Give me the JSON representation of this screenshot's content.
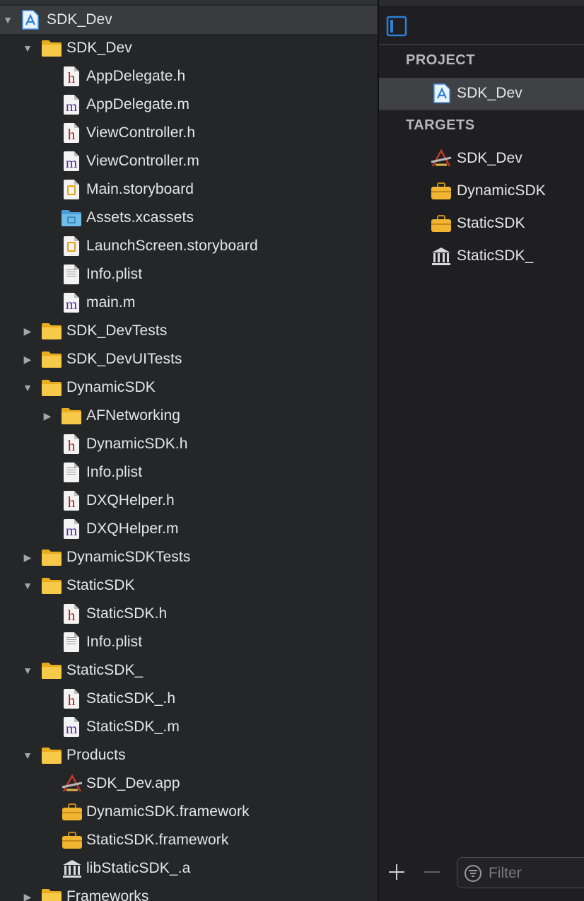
{
  "navigator": {
    "rows": [
      {
        "label": "SDK_Dev",
        "icon": "xcodeproj-icon",
        "disclosure": "open"
      },
      {
        "label": "SDK_Dev",
        "icon": "folder-icon",
        "disclosure": "open"
      },
      {
        "label": "AppDelegate.h",
        "icon": "header-file-icon"
      },
      {
        "label": "AppDelegate.m",
        "icon": "objc-file-icon"
      },
      {
        "label": "ViewController.h",
        "icon": "header-file-icon"
      },
      {
        "label": "ViewController.m",
        "icon": "objc-file-icon"
      },
      {
        "label": "Main.storyboard",
        "icon": "storyboard-icon"
      },
      {
        "label": "Assets.xcassets",
        "icon": "assets-folder-icon"
      },
      {
        "label": "LaunchScreen.storyboard",
        "icon": "storyboard-icon"
      },
      {
        "label": "Info.plist",
        "icon": "plist-file-icon"
      },
      {
        "label": "main.m",
        "icon": "objc-file-icon"
      },
      {
        "label": "SDK_DevTests",
        "icon": "folder-icon",
        "disclosure": "closed"
      },
      {
        "label": "SDK_DevUITests",
        "icon": "folder-icon",
        "disclosure": "closed"
      },
      {
        "label": "DynamicSDK",
        "icon": "folder-icon",
        "disclosure": "open"
      },
      {
        "label": "AFNetworking",
        "icon": "folder-icon",
        "disclosure": "closed"
      },
      {
        "label": "DynamicSDK.h",
        "icon": "header-file-icon"
      },
      {
        "label": "Info.plist",
        "icon": "plist-file-icon"
      },
      {
        "label": "DXQHelper.h",
        "icon": "header-file-icon"
      },
      {
        "label": "DXQHelper.m",
        "icon": "objc-file-icon"
      },
      {
        "label": "DynamicSDKTests",
        "icon": "folder-icon",
        "disclosure": "closed"
      },
      {
        "label": "StaticSDK",
        "icon": "folder-icon",
        "disclosure": "open"
      },
      {
        "label": "StaticSDK.h",
        "icon": "header-file-icon"
      },
      {
        "label": "Info.plist",
        "icon": "plist-file-icon"
      },
      {
        "label": "StaticSDK_",
        "icon": "folder-icon",
        "disclosure": "open"
      },
      {
        "label": "StaticSDK_.h",
        "icon": "header-file-icon"
      },
      {
        "label": "StaticSDK_.m",
        "icon": "objc-file-icon"
      },
      {
        "label": "Products",
        "icon": "folder-icon",
        "disclosure": "open"
      },
      {
        "label": "SDK_Dev.app",
        "icon": "app-icon"
      },
      {
        "label": "DynamicSDK.framework",
        "icon": "framework-icon"
      },
      {
        "label": "StaticSDK.framework",
        "icon": "framework-icon"
      },
      {
        "label": "libStaticSDK_.a",
        "icon": "library-icon"
      },
      {
        "label": "Frameworks",
        "icon": "folder-icon",
        "disclosure": "closed"
      }
    ]
  },
  "editor_sidebar": {
    "toggle_icon": "sidebar-toggle-icon",
    "project_header": "PROJECT",
    "project_item": {
      "label": "SDK_Dev",
      "icon": "xcodeproj-icon"
    },
    "targets_header": "TARGETS",
    "targets": [
      {
        "label": "SDK_Dev",
        "icon": "app-icon"
      },
      {
        "label": "DynamicSDK",
        "icon": "framework-icon"
      },
      {
        "label": "StaticSDK",
        "icon": "framework-icon"
      },
      {
        "label": "StaticSDK_",
        "icon": "library-icon"
      }
    ],
    "add_icon": "plus-icon",
    "remove_icon": "minus-icon",
    "filter_placeholder": "Filter",
    "filter_icon": "filter-icon"
  },
  "colors": {
    "navigator_bg": "#252628",
    "selection_bg": "#3a3b3d",
    "folder_yellow": "#f5c242",
    "accent_blue": "#2e7fd6"
  }
}
